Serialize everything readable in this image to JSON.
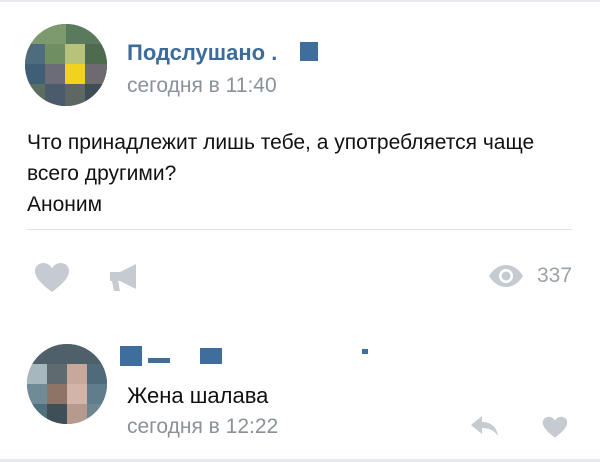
{
  "post": {
    "author": "Подслушано .",
    "time": "сегодня в 11:40",
    "text_lines": [
      "Что принадлежит лишь тебе, а употребляется чаще",
      "всего другими?",
      "Аноним"
    ]
  },
  "actions": {
    "like_icon": "heart-icon",
    "share_icon": "megaphone-icon",
    "views_icon": "eye-icon",
    "views_count": "337"
  },
  "comment": {
    "text": "Жена шалава",
    "time": "сегодня в 12:22",
    "reply_icon": "reply-icon",
    "like_icon": "heart-icon"
  },
  "colors": {
    "author_blue": "#3d6b9a",
    "meta_gray": "#8a9199",
    "icon_gray": "#c5cbd1"
  }
}
